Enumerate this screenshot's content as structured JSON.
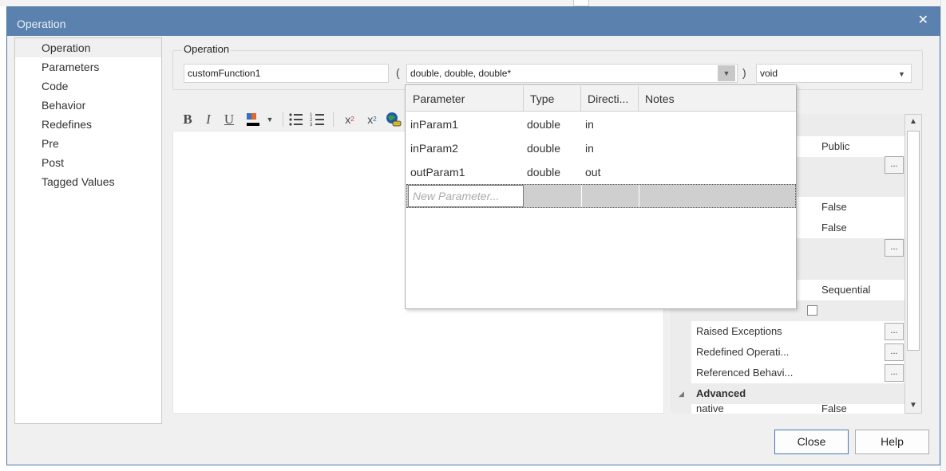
{
  "window": {
    "title": "Operation",
    "close_glyph": "✕"
  },
  "nav": {
    "items": [
      "Operation",
      "Parameters",
      "Code",
      "Behavior",
      "Redefines",
      "Pre",
      "Post",
      "Tagged Values"
    ],
    "selected_index": 0
  },
  "operation_group": {
    "label": "Operation",
    "name_value": "customFunction1",
    "open_paren": "(",
    "params_value": "double, double, double*",
    "close_paren": ")",
    "return_type": "void"
  },
  "toolbar": {
    "bold": "B",
    "italic": "I",
    "underline": "U",
    "color_letters": "A",
    "superscript": "x",
    "superscript_mark": "2",
    "subscript": "x",
    "subscript_mark": "2"
  },
  "param_popup": {
    "columns": [
      "Parameter",
      "Type",
      "Directi...",
      "Notes"
    ],
    "rows": [
      {
        "name": "inParam1",
        "type": "double",
        "direction": "in",
        "notes": ""
      },
      {
        "name": "inParam2",
        "type": "double",
        "direction": "in",
        "notes": ""
      },
      {
        "name": "outParam1",
        "type": "double",
        "direction": "out",
        "notes": ""
      }
    ],
    "new_placeholder": "New Parameter..."
  },
  "properties": {
    "visible_values": {
      "scope": "Public",
      "v1": "False",
      "v2": "False",
      "concurrency": "Sequential"
    },
    "rows": {
      "raised_exceptions": "Raised Exceptions",
      "redefined_operations": "Redefined Operati...",
      "referenced_behavior": "Referenced Behavi...",
      "advanced_category": "Advanced",
      "native_label": "native",
      "native_value": "False"
    },
    "ellipsis": "..."
  },
  "buttons": {
    "close": "Close",
    "help": "Help"
  },
  "colors": {
    "titlebar": "#5b81ae",
    "dialog_bg": "#f0f0f0",
    "accent_border": "#4a78b3"
  }
}
